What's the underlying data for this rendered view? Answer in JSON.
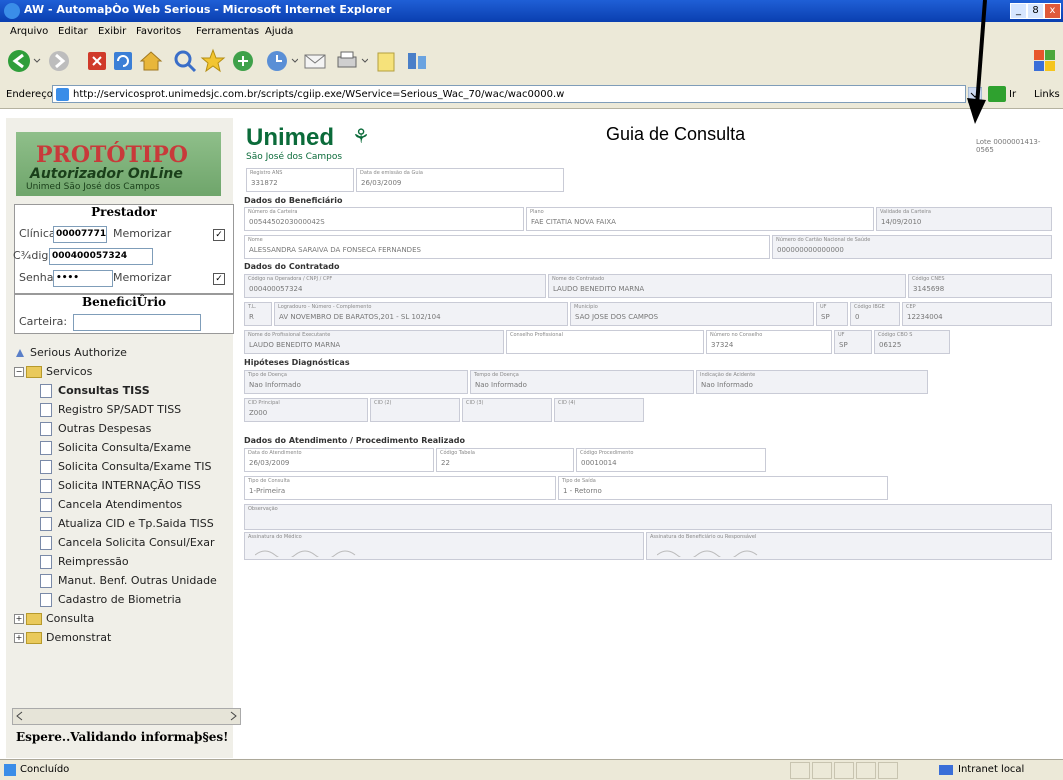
{
  "window": {
    "title": "AW - AutomaþÒo Web Serious - Microsoft Internet Explorer",
    "min": "_",
    "max": "8",
    "close": "x"
  },
  "menu": [
    "Arquivo",
    "Editar",
    "Exibir",
    "Favoritos",
    "Ferramentas",
    "Ajuda"
  ],
  "address": {
    "label": "Endereço",
    "url": "http://servicosprot.unimedsjc.com.br/scripts/cgiip.exe/WService=Serious_Wac_70/wac/wac0000.w",
    "go": "Ir",
    "links": "Links"
  },
  "sidebar": {
    "logo_line1": "PROTÓTIPO",
    "logo_line2": "Autorizador OnLine",
    "logo_line3": "Unimed São José dos Campos",
    "prestador": {
      "heading": "Prestador",
      "clinica_label": "Clínica:",
      "clinica_value": "00007771",
      "codigo_label": "C¾digo:",
      "codigo_value": "000400057324",
      "senha_label": "Senha:",
      "senha_value": "••••",
      "memorizar_label": "Memorizar",
      "memorizar2_label": "Memorizar"
    },
    "beneficiario": {
      "heading": "BeneficiÛrio",
      "carteira_label": "Carteira:",
      "carteira_value": ""
    },
    "tree": {
      "root": "Serious Authorize",
      "servicos": "Servicos",
      "items": [
        "Consultas TISS",
        "Registro SP/SADT TISS",
        "Outras Despesas",
        "Solicita Consulta/Exame",
        "Solicita Consulta/Exame TIS",
        "Solicita INTERNAÇÃO TISS",
        "Cancela Atendimentos",
        "Atualiza CID e Tp.Saida TISS",
        "Cancela Solicita Consul/Exar",
        "Reimpressão",
        "Manut. Benf. Outras Unidade",
        "Cadastro de Biometria"
      ],
      "consulta": "Consulta",
      "demonstrat": "Demonstrat"
    },
    "status_msg": "Espere..Validando informaþ§es!"
  },
  "form": {
    "brand": "Unimed",
    "brand_sub": "São José dos Campos",
    "title": "Guia de Consulta",
    "guide_number": "Lote 0000001413-0565",
    "top_fields": [
      {
        "label": "Registro ANS",
        "value": "331872"
      },
      {
        "label": "Data de emissão da Guia",
        "value": "26/03/2009"
      }
    ],
    "sections": {
      "beneficiario": "Dados do Beneficiário",
      "contratado": "Dados do Contratado",
      "hipoteses": "Hipóteses Diagnósticas",
      "atendimento": "Dados do Atendimento / Procedimento Realizado"
    },
    "benef": {
      "carteira": {
        "label": "Número da Carteira",
        "value": "0054450203000042S"
      },
      "plano": {
        "label": "Plano",
        "value": "FAE CITATIA NOVA FAIXA"
      },
      "validade": {
        "label": "Validade da Carteira",
        "value": "14/09/2010"
      },
      "nome": {
        "label": "Nome",
        "value": "ALESSANDRA SARAIVA DA FONSECA FERNANDES"
      },
      "cns": {
        "label": "Número do Cartão Nacional de Saúde",
        "value": "000000000000000"
      }
    },
    "contratado": {
      "codigo": {
        "label": "Código na Operadora / CNPJ / CPF",
        "value": "000400057324"
      },
      "nome": {
        "label": "Nome do Contratado",
        "value": "LAUDO BENEDITO MARNA"
      },
      "cnes": {
        "label": "Código CNES",
        "value": "3145698"
      },
      "tl": {
        "label": "T.L.",
        "value": "R"
      },
      "logradouro": {
        "label": "Logradouro - Número - Complemento",
        "value": "AV NOVEMBRO DE BARATOS,201 - SL 102/104"
      },
      "municipio": {
        "label": "Município",
        "value": "SAO JOSE DOS CAMPOS"
      },
      "uf": {
        "label": "UF",
        "value": "SP"
      },
      "cod_ibge": {
        "label": "Código IBGE",
        "value": "0"
      },
      "cep": {
        "label": "CEP",
        "value": "12234004"
      },
      "profissional": {
        "label": "Nome do Profissional Executante",
        "value": "LAUDO BENEDITO MARNA"
      },
      "conselho": {
        "label": "Conselho Profissional",
        "value": ""
      },
      "num_conselho": {
        "label": "Número no Conselho",
        "value": "37324"
      },
      "uf2": {
        "label": "UF",
        "value": "SP"
      },
      "cbos": {
        "label": "Código CBO S",
        "value": "06125"
      }
    },
    "hipoteses": {
      "tipo_doenca": {
        "label": "Tipo de Doença",
        "value": "Nao Informado"
      },
      "tempo_doenca": {
        "label": "Tempo de Doença",
        "value": "Nao Informado"
      },
      "indicacao": {
        "label": "Indicação de Acidente",
        "value": "Nao Informado"
      },
      "cid_principal": {
        "label": "CID Principal",
        "value": "Z000"
      },
      "cid2": {
        "label": "CID (2)",
        "value": ""
      },
      "cid3": {
        "label": "CID (3)",
        "value": ""
      },
      "cid4": {
        "label": "CID (4)",
        "value": ""
      }
    },
    "atendimento": {
      "data": {
        "label": "Data do Atendimento",
        "value": "26/03/2009"
      },
      "cod_tabela": {
        "label": "Código Tabela",
        "value": "22"
      },
      "cod_proc": {
        "label": "Código Procedimento",
        "value": "00010014"
      },
      "tipo_consulta": {
        "label": "Tipo de Consulta",
        "value": "1-Primeira"
      },
      "tipo_saida": {
        "label": "Tipo de Saída",
        "value": "1 - Retorno"
      },
      "observacao": {
        "label": "Observação",
        "value": ""
      },
      "assinatura_medico": "Assinatura do Médico",
      "assinatura_benef": "Assinatura do Beneficiário ou Responsável"
    }
  },
  "statusbar": {
    "text": "Concluído",
    "zone": "Intranet local"
  }
}
